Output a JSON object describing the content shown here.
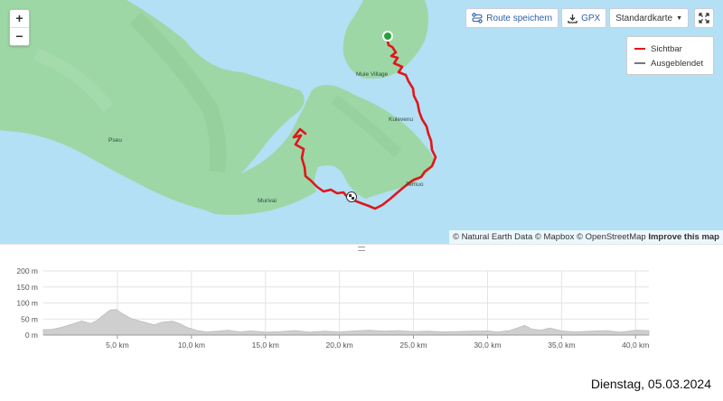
{
  "map": {
    "zoom_in": "+",
    "zoom_out": "−",
    "toolbar": {
      "save_route": "Route speichern",
      "gpx": "GPX",
      "map_style": "Standardkarte"
    },
    "legend": [
      {
        "label": "Sichtbar",
        "color": "#e0161b"
      },
      {
        "label": "Ausgeblendet",
        "color": "#777777"
      }
    ],
    "attribution": {
      "text": "© Natural Earth Data © Mapbox © OpenStreetMap",
      "link": "Improve this map"
    },
    "places": {
      "muie": "Muie Village",
      "kulevenu": "Kulevenu",
      "pseu": "Pseu",
      "temuo": "Temuo",
      "murivai": "Murivai"
    },
    "colors": {
      "water": "#b3e0f5",
      "land": "#9dd7a6",
      "route": "#e0161b",
      "start": "#22a33a"
    }
  },
  "chart_data": {
    "type": "area",
    "title": "",
    "xlabel": "",
    "ylabel": "",
    "xlim": [
      0,
      40.9
    ],
    "ylim": [
      0,
      200
    ],
    "x_ticks": [
      "5,0 km",
      "10,0 km",
      "15,0 km",
      "20,0 km",
      "25,0 km",
      "30,0 km",
      "35,0 km",
      "40,0 km"
    ],
    "y_ticks": [
      "200 m",
      "150 m",
      "100 m",
      "50 m",
      "0 m"
    ],
    "grid": true,
    "series": [
      {
        "x": [
          0,
          0.6,
          1.2,
          2.0,
          2.6,
          3.2,
          3.6,
          4.0,
          4.5,
          4.9,
          5.4,
          5.9,
          6.5,
          7.0,
          7.5,
          8.0,
          8.7,
          9.2,
          9.7,
          10.4,
          11.0,
          11.8,
          12.5,
          13.3,
          14.0,
          15.0,
          16.0,
          17.0,
          18.0,
          19.0,
          20.0,
          21.0,
          22.0,
          23.0,
          24.0,
          25.0,
          26.0,
          27.0,
          28.0,
          29.0,
          30.0,
          30.7,
          31.5,
          32.0,
          32.5,
          33.0,
          33.6,
          34.2,
          35.0,
          36.0,
          37.0,
          38.0,
          39.0,
          40.0,
          40.9
        ],
        "values": [
          17,
          18,
          24,
          35,
          44,
          36,
          45,
          60,
          78,
          80,
          65,
          52,
          44,
          38,
          32,
          40,
          43,
          36,
          24,
          14,
          10,
          12,
          15,
          10,
          13,
          9,
          11,
          14,
          9,
          12,
          10,
          13,
          15,
          12,
          14,
          11,
          12,
          10,
          11,
          12,
          13,
          10,
          14,
          22,
          30,
          19,
          15,
          22,
          13,
          10,
          12,
          14,
          9,
          15,
          14
        ]
      }
    ]
  },
  "footer": {
    "date": "Dienstag, 05.03.2024"
  }
}
